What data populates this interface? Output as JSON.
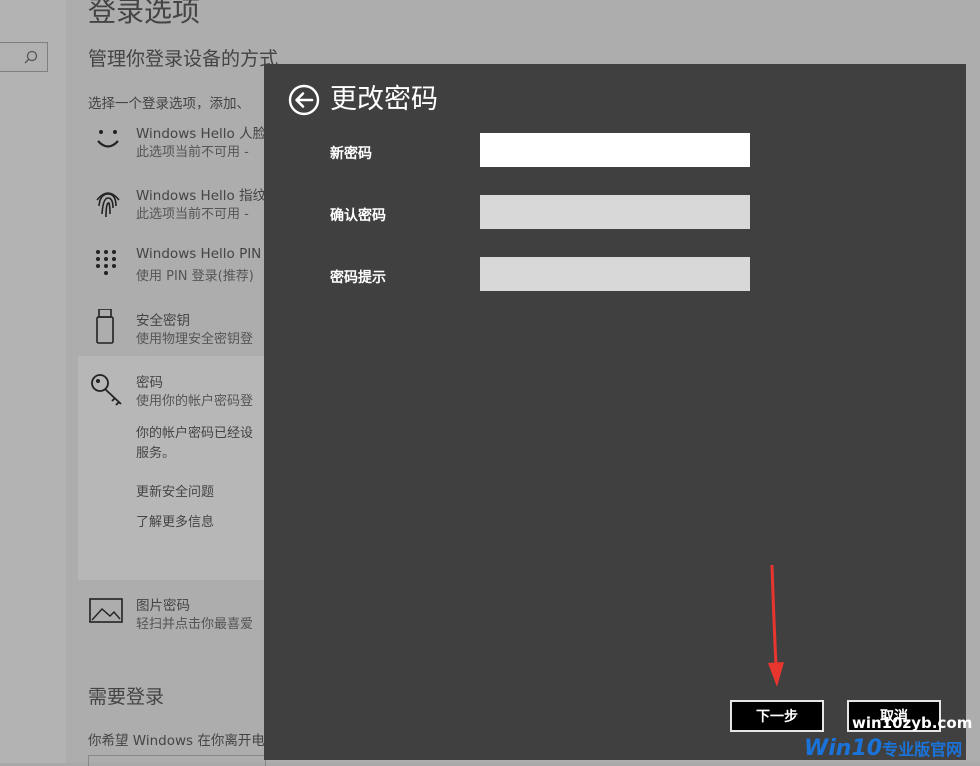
{
  "settings": {
    "page_title": "登录选项",
    "section_title": "管理你登录设备的方式",
    "section_desc": "选择一个登录选项，添加、",
    "options": [
      {
        "title": "Windows Hello 人脸",
        "subtitle": "此选项当前不可用 -",
        "icon": "face-icon"
      },
      {
        "title": "Windows Hello 指纹",
        "subtitle": "此选项当前不可用 -",
        "icon": "fingerprint-icon"
      },
      {
        "title": "Windows Hello PIN",
        "subtitle": "使用 PIN 登录(推荐)",
        "icon": "keypad-icon"
      },
      {
        "title": "安全密钥",
        "subtitle": "使用物理安全密钥登",
        "icon": "usb-key-icon"
      },
      {
        "title": "密码",
        "subtitle": "使用你的帐户密码登",
        "icon": "key-icon"
      },
      {
        "title": "图片密码",
        "subtitle": "轻扫并点击你最喜爱",
        "icon": "picture-icon"
      }
    ],
    "password_info_line1": "你的帐户密码已经设",
    "password_info_line2": "服务。",
    "link_security_questions": "更新安全问题",
    "link_learn_more": "了解更多信息",
    "need_signin_title": "需要登录",
    "need_signin_desc": "你希望 Windows 在你离开电"
  },
  "dialog": {
    "title": "更改密码",
    "fields": [
      {
        "label": "新密码",
        "value": ""
      },
      {
        "label": "确认密码",
        "value": ""
      },
      {
        "label": "密码提示",
        "value": ""
      }
    ],
    "next_button": "下一步",
    "cancel_button": "取消"
  },
  "watermark": {
    "url": "win10zyb.com",
    "brand": "Win10",
    "brand_suffix": "专业版官网"
  },
  "colors": {
    "dialog_bg": "#414041",
    "annotation_arrow": "#e8352e",
    "watermark_blue": "#1a73d9"
  }
}
